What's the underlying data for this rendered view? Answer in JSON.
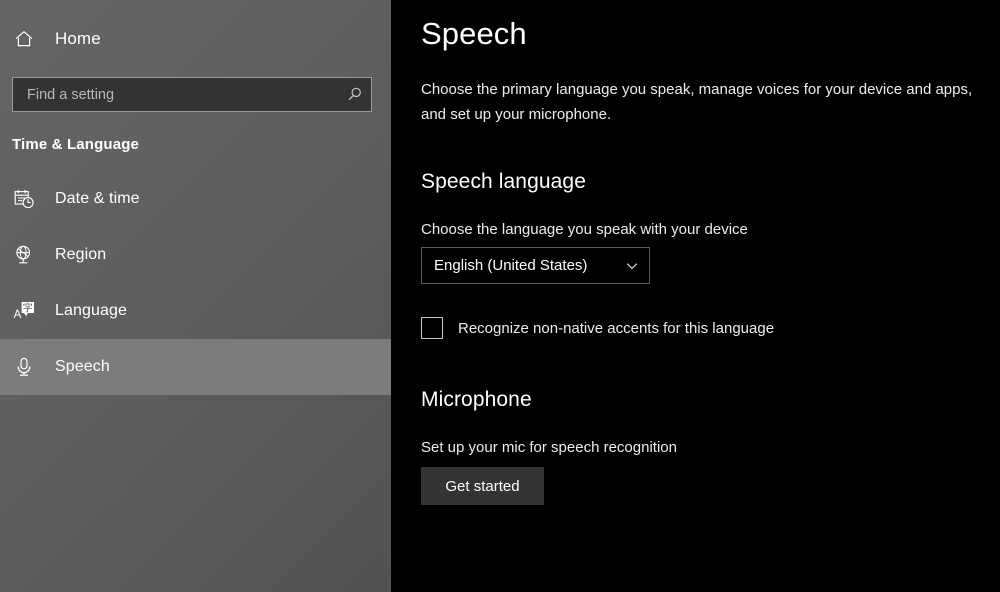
{
  "sidebar": {
    "home": {
      "label": "Home",
      "icon": "home-icon"
    },
    "search": {
      "placeholder": "Find a setting",
      "value": "",
      "icon": "search-icon"
    },
    "category_title": "Time & Language",
    "items": [
      {
        "label": "Date & time",
        "icon": "calendar-clock-icon",
        "selected": false
      },
      {
        "label": "Region",
        "icon": "globe-icon",
        "selected": false
      },
      {
        "label": "Language",
        "icon": "translate-icon",
        "selected": false
      },
      {
        "label": "Speech",
        "icon": "microphone-icon",
        "selected": true
      }
    ]
  },
  "main": {
    "title": "Speech",
    "description": "Choose the primary language you speak, manage voices for your device and apps, and set up your microphone.",
    "speech_language": {
      "heading": "Speech language",
      "field_label": "Choose the language you speak with your device",
      "selected_language": "English (United States)",
      "checkbox_label": "Recognize non-native accents for this language",
      "checkbox_checked": false
    },
    "microphone": {
      "heading": "Microphone",
      "description": "Set up your mic for speech recognition",
      "button_label": "Get started"
    }
  },
  "colors": {
    "sidebar_top": "#656565",
    "sidebar_bottom": "#4f5152",
    "selected_row": "#7b7d7d",
    "main_background": "#000000",
    "button_fill": "#333333",
    "search_fill": "#333333",
    "border": "#5a5a5a"
  }
}
